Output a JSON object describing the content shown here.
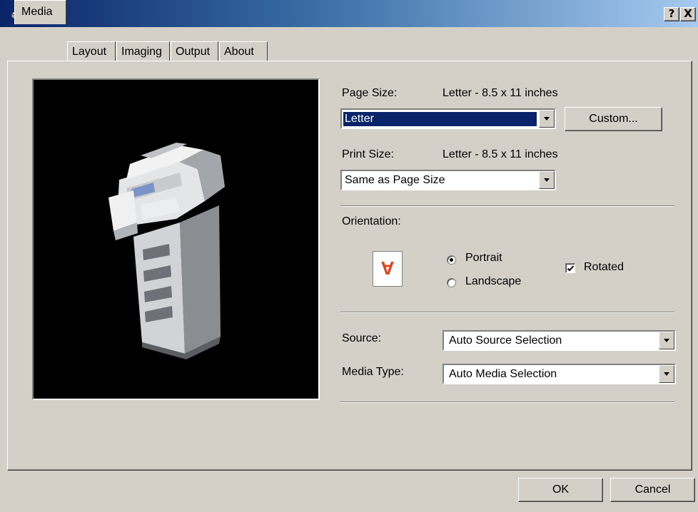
{
  "window": {
    "help_label": "?",
    "close_label": "X"
  },
  "tabs": [
    {
      "label": "Media",
      "active": true
    },
    {
      "label": "Layout"
    },
    {
      "label": "Imaging"
    },
    {
      "label": "Output"
    },
    {
      "label": "About"
    }
  ],
  "media": {
    "page_size_label": "Page Size:",
    "page_size_value": "Letter - 8.5 x 11 inches",
    "page_size_selected": "Letter",
    "custom_button": "Custom...",
    "print_size_label": "Print Size:",
    "print_size_value": "Letter - 8.5 x 11 inches",
    "print_size_selected": "Same as Page Size",
    "orientation_label": "Orientation:",
    "orientation_icon_glyph": "A",
    "portrait_label": "Portrait",
    "landscape_label": "Landscape",
    "rotated_label": "Rotated",
    "source_label": "Source:",
    "source_selected": "Auto Source Selection",
    "media_type_label": "Media Type:",
    "media_type_selected": "Auto Media Selection"
  },
  "footer": {
    "ok_label": "OK",
    "cancel_label": "Cancel"
  },
  "colors": {
    "face": "#d4d0c8",
    "title_start": "#0a246a",
    "title_end": "#a6caf0",
    "selection": "#0a246a",
    "orientation_icon": "#e0401a"
  },
  "icons": {
    "title": "printer-icon",
    "orientation": "portrait-rotated-page-icon"
  }
}
